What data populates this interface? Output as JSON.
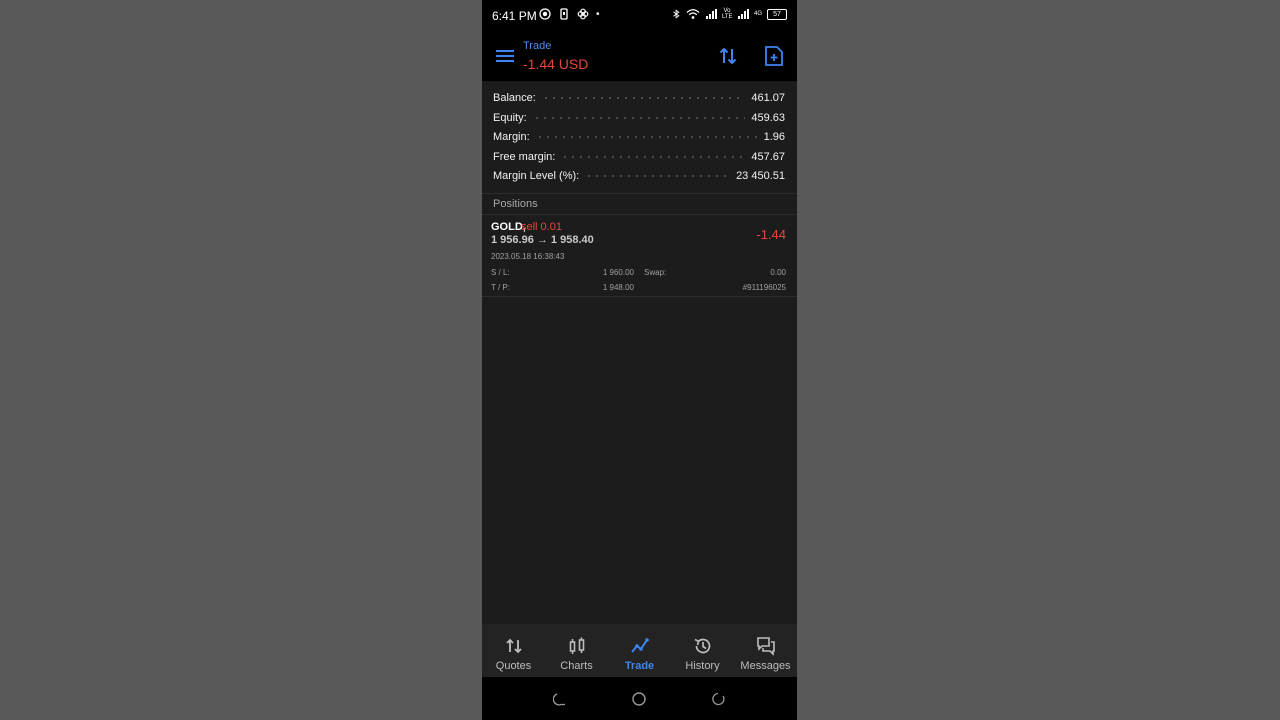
{
  "status_bar": {
    "time": "6:41 PM",
    "dot": "•",
    "network_label": "Vo LTE",
    "data_label": "4G",
    "battery": "57"
  },
  "header": {
    "title": "Trade",
    "pl": "-1.44 USD"
  },
  "summary": {
    "rows": [
      {
        "label": "Balance:",
        "value": "461.07"
      },
      {
        "label": "Equity:",
        "value": "459.63"
      },
      {
        "label": "Margin:",
        "value": "1.96"
      },
      {
        "label": "Free margin:",
        "value": "457.67"
      },
      {
        "label": "Margin Level (%):",
        "value": "23 450.51"
      }
    ]
  },
  "positions": {
    "header": "Positions",
    "items": [
      {
        "symbol": "GOLD,",
        "type": "sell 0.01",
        "prices": "1 956.96 → 1 958.40",
        "profit": "-1.44",
        "date": "2023.05.18 16:38:43",
        "sl_label": "S / L:",
        "sl_value": "1 960.00",
        "swap_label": "Swap:",
        "swap_value": "0.00",
        "tp_label": "T / P:",
        "tp_value": "1 948.00",
        "ticket": "#911196025"
      }
    ]
  },
  "nav": {
    "items": [
      {
        "label": "Quotes",
        "icon": "quotes-icon"
      },
      {
        "label": "Charts",
        "icon": "charts-icon"
      },
      {
        "label": "Trade",
        "icon": "trade-icon"
      },
      {
        "label": "History",
        "icon": "history-icon"
      },
      {
        "label": "Messages",
        "icon": "messages-icon"
      }
    ],
    "active": "Trade"
  },
  "colors": {
    "accent": "#3e85f0",
    "loss": "#e8453c",
    "background": "#1c1c1c",
    "header_bg": "#000000"
  }
}
